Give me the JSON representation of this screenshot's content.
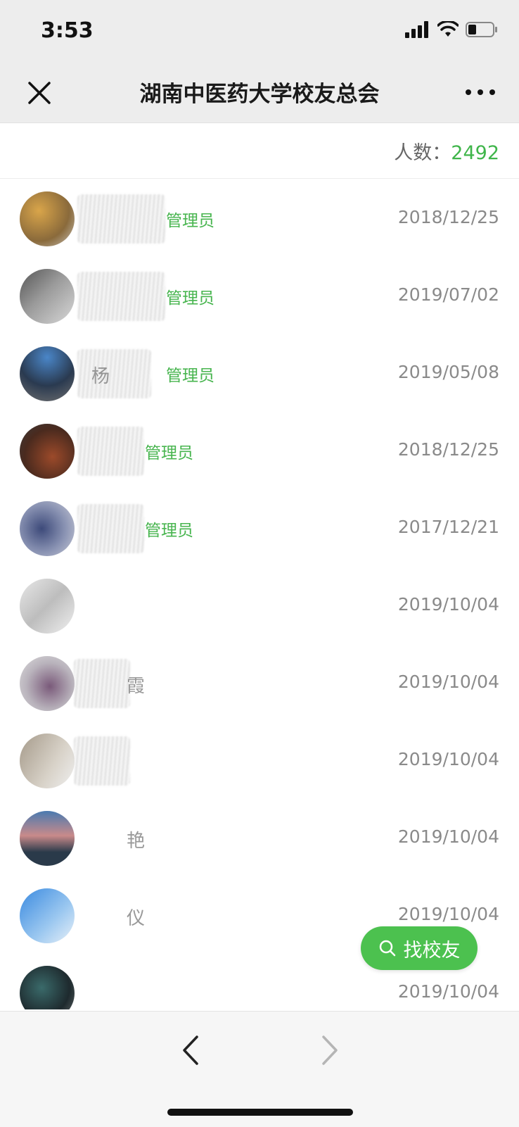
{
  "status": {
    "time": "3:53"
  },
  "nav": {
    "title": "湖南中医药大学校友总会",
    "close_icon": "close-icon",
    "more_icon": "more-dots-icon"
  },
  "header": {
    "count_label": "人数：",
    "count_value": "2492"
  },
  "members": [
    {
      "name": "",
      "role": "管理员",
      "date": "2018/12/25"
    },
    {
      "name": "",
      "role": "管理员",
      "date": "2019/07/02"
    },
    {
      "name": "杨",
      "role": "管理员",
      "date": "2019/05/08"
    },
    {
      "name": "",
      "role": "管理员",
      "date": "2018/12/25"
    },
    {
      "name": "",
      "role": "管理员",
      "date": "2017/12/21"
    },
    {
      "name": "",
      "role": "",
      "date": "2019/10/04"
    },
    {
      "name": "霞",
      "role": "",
      "date": "2019/10/04"
    },
    {
      "name": "",
      "role": "",
      "date": "2019/10/04"
    },
    {
      "name": "艳",
      "role": "",
      "date": "2019/10/04"
    },
    {
      "name": "仪",
      "role": "",
      "date": "2019/10/04"
    },
    {
      "name": "",
      "role": "",
      "date": "2019/10/04"
    }
  ],
  "fab": {
    "label": "找校友",
    "icon": "search-icon"
  },
  "toolbar": {
    "back_icon": "chevron-left-icon",
    "forward_icon": "chevron-right-icon"
  },
  "colors": {
    "accent": "#4cc14f",
    "role_green": "#48b54f",
    "nav_bg": "#ededed"
  }
}
